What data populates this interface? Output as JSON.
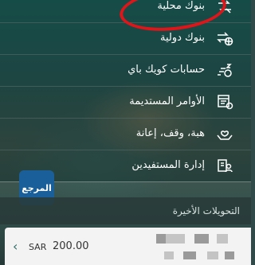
{
  "menu": {
    "items": [
      {
        "label": "بنوك محلية",
        "icon": "transfer-arrow-icon"
      },
      {
        "label": "بنوك دولية",
        "icon": "international-transfer-icon"
      },
      {
        "label": "حسابات كويك باي",
        "icon": "quick-pay-icon"
      },
      {
        "label": "الأوامر المستديمة",
        "icon": "standing-orders-icon"
      },
      {
        "label": "هبة، وقف، إعانة",
        "icon": "donation-hands-icon"
      },
      {
        "label": "إدارة المستفيدين",
        "icon": "beneficiaries-icon"
      }
    ]
  },
  "recent": {
    "title": "التحويلات الأخيرة",
    "rows": [
      {
        "currency": "SAR",
        "amount": "200.00"
      }
    ]
  },
  "colors": {
    "highlight": "#e0151a",
    "accent": "#2e6e68",
    "logo_bg": "#1b5f9a"
  },
  "logo": {
    "text": "المرجع"
  }
}
